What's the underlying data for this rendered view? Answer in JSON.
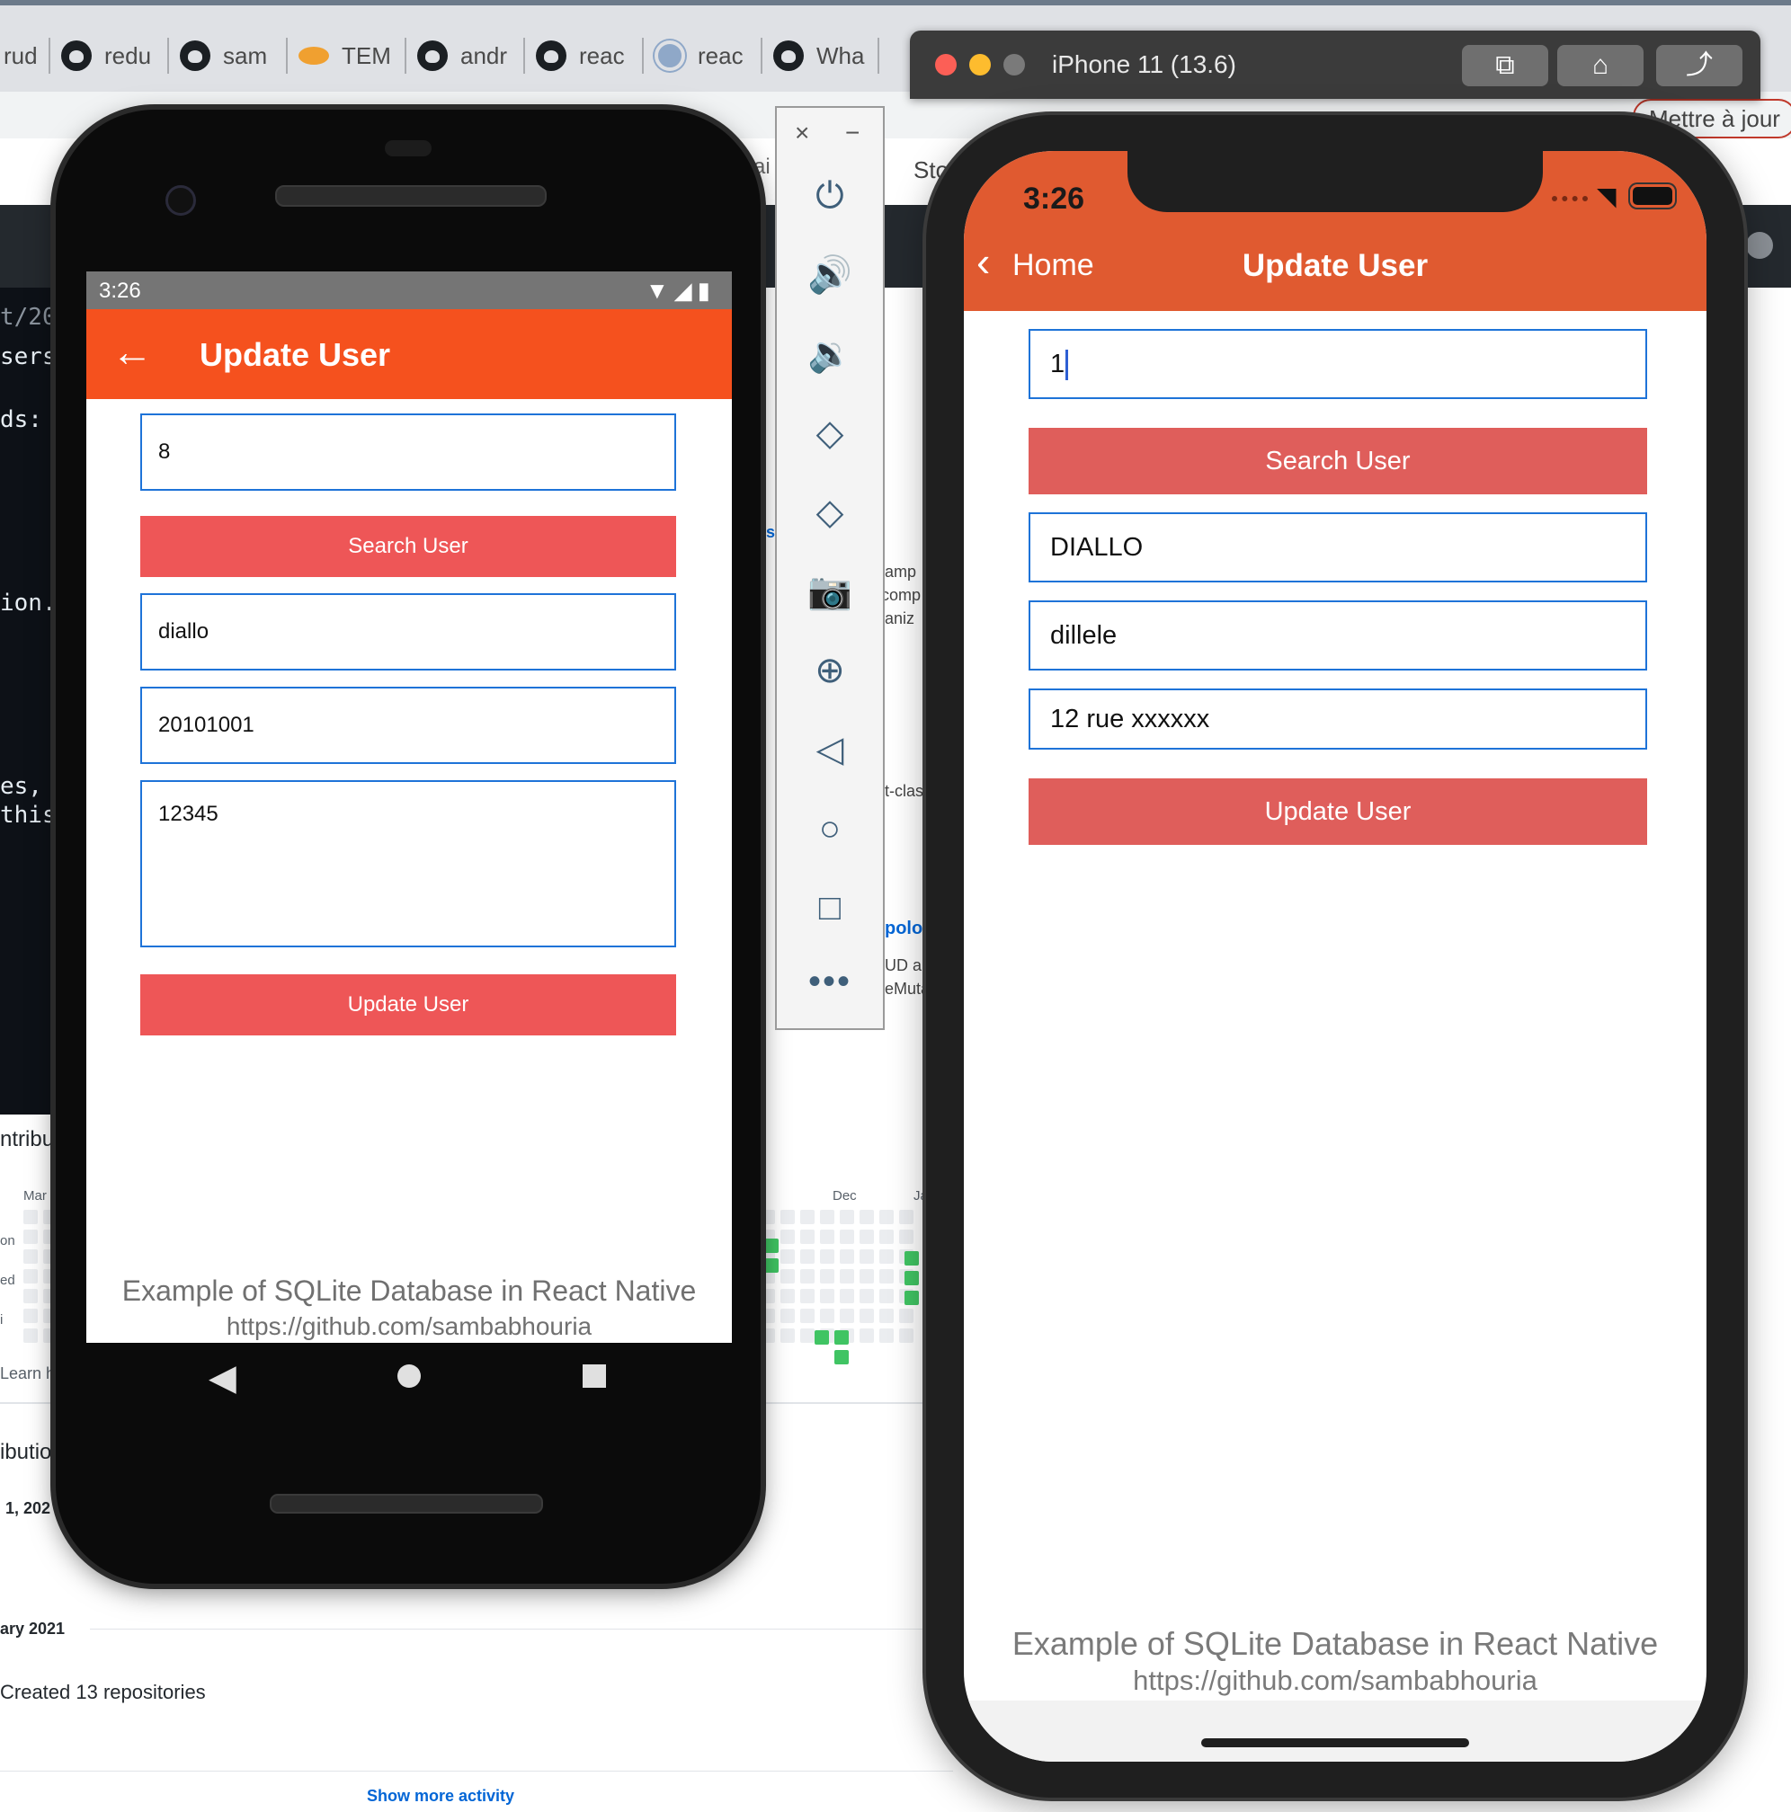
{
  "browser": {
    "tabs": [
      {
        "label": "rud",
        "icon": "github-icon"
      },
      {
        "label": "redu",
        "icon": "github-icon"
      },
      {
        "label": "sam",
        "icon": "github-icon"
      },
      {
        "label": "TEM",
        "icon": "pastry-icon"
      },
      {
        "label": "andr",
        "icon": "github-icon"
      },
      {
        "label": "reac",
        "icon": "github-icon"
      },
      {
        "label": "reac",
        "icon": "atom-icon"
      },
      {
        "label": "Wha",
        "icon": "github-icon"
      }
    ],
    "update_button": "Mettre à jour",
    "bookmark_partial": "Sto"
  },
  "background_page": {
    "code_lines": [
      "t/202",
      "sers/",
      "ds:",
      "ion.",
      "es, c",
      "this"
    ],
    "contrib_label": "ntribu",
    "months": {
      "mar": "Mar",
      "dec": "Dec",
      "jan": "Ja"
    },
    "days": {
      "mon": "on",
      "wed": "ed",
      "fri": "i"
    },
    "learn": "Learn h",
    "contrib_heading": "ibution",
    "date_partial": "1, 202",
    "year_heading": "ary 2021",
    "activity": "Created 13 repositories",
    "show_more": "Show more activity",
    "snippets": {
      "s1": "s",
      "s2": "amp",
      "s3": "comp",
      "s4": "aniz",
      "s5": "t-clas",
      "s6": "polo-",
      "s7": "UD ap",
      "s8": "eMuta",
      "s9": "ai"
    }
  },
  "android": {
    "status_time": "3:26",
    "title": "Update User",
    "user_id": "8",
    "search_label": "Search User",
    "name": "diallo",
    "contact": "20101001",
    "address": "12345",
    "update_label": "Update User",
    "footer_title": "Example of SQLite Database in React Native",
    "footer_url": "https://github.com/sambabhouria"
  },
  "emulator_toolbar": {
    "close": "×",
    "minimize": "−",
    "tools": [
      "power-icon",
      "volume-up-icon",
      "volume-down-icon",
      "rotate-left-icon",
      "rotate-right-icon",
      "camera-icon",
      "zoom-icon",
      "back-icon",
      "home-icon",
      "overview-icon",
      "more-icon"
    ]
  },
  "ios_simulator": {
    "window_title": "iPhone 11 (13.6)",
    "status_time": "3:26",
    "back_label": "Home",
    "title": "Update User",
    "user_id": "1",
    "search_label": "Search User",
    "name": "DIALLO",
    "contact": "dillele",
    "address": "12 rue xxxxxx",
    "update_label": "Update User",
    "footer_title": "Example of SQLite Database in React Native",
    "footer_url": "https://github.com/sambabhouria"
  },
  "colors": {
    "android_appbar": "#f5511e",
    "ios_header": "#e05a30",
    "button": "#ee5657",
    "input_border": "#1e73d8"
  }
}
